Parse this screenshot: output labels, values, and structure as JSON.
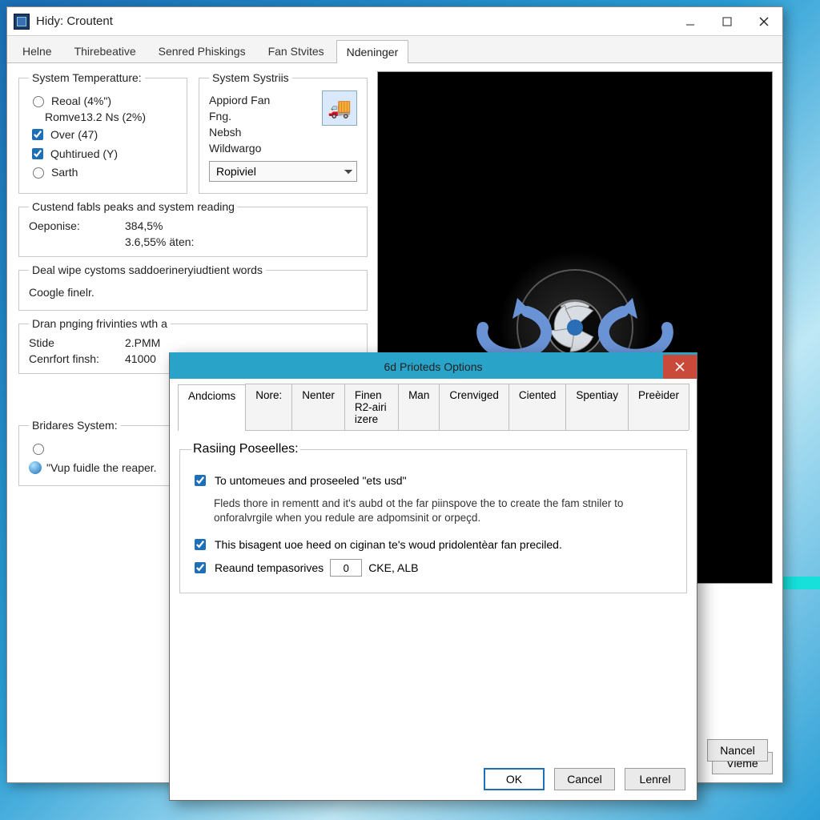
{
  "main_window": {
    "title": "Hidy: Croutent",
    "tabs": [
      "Helne",
      "Thirebeative",
      "Senred Phiskings",
      "Fan Stvites",
      "Ndeninger"
    ],
    "active_tab_index": 4,
    "group_temp": {
      "legend": "System Temperatture:",
      "items": [
        {
          "type": "radio",
          "checked": false,
          "label": "Reoal (4%\")"
        },
        {
          "type": "text",
          "label": "Romve13.2 Ns (2%)"
        },
        {
          "type": "check",
          "checked": true,
          "label": "Over (47)"
        },
        {
          "type": "check",
          "checked": true,
          "label": "Quhtirued (Y)"
        },
        {
          "type": "radio",
          "checked": false,
          "label": "Sarth"
        }
      ]
    },
    "group_systris": {
      "legend": "System Systriis",
      "lines": [
        "Appiord Fan",
        "Fng.",
        "Nebsh",
        "Wildwargo"
      ],
      "combo_value": "Ropiviel"
    },
    "group_readings": {
      "legend": "Custend fabls peaks and system reading",
      "rows": [
        [
          "Oeponise:",
          "384,5%"
        ],
        [
          "",
          "3.6,55% äten:"
        ]
      ]
    },
    "group_deal": {
      "legend": "Deal wipe cystoms saddoerineryiudtient words",
      "label": "Coogle finelr."
    },
    "group_dran": {
      "legend": "Dran pnging frivinties wth a",
      "rows": [
        [
          "Stide",
          "2.PMM"
        ],
        [
          "Cenrfort finsh:",
          "41000"
        ]
      ]
    },
    "group_bridares": {
      "legend": "Bridares System:",
      "radio_label": "",
      "orb_label": "\"Vup fuidle the reaper."
    },
    "right_button": "Vieme",
    "footer_button": "Nancel"
  },
  "dialog": {
    "title": "6d Prioteds Options",
    "tabs": [
      "Andcioms",
      "Nore:",
      "Nenter",
      "Finen R2-airi izere",
      "Man",
      "Crenviged",
      "Ciented",
      "Spentiay",
      "Preèider"
    ],
    "active_tab_index": 0,
    "fieldset_legend": "Rasiing Poseelles:",
    "check1_label": "To untomeues and proseeled \"ets usd\"",
    "desc": "Fleds thore in rementt and it's aubd ot the far piinspove the to create the fam stniler to onforalvrgile when you redule are adpomsinit or orpeçd.",
    "check2_label": "This bisagent uoe heed on ciginan te's woud pridolentèar fan preciled.",
    "check3_label": "Reaund tempasorives",
    "num_value": "0",
    "num_unit": "CKE, ALB",
    "buttons": {
      "ok": "OK",
      "cancel": "Cancel",
      "lenrel": "Lenrel"
    }
  }
}
